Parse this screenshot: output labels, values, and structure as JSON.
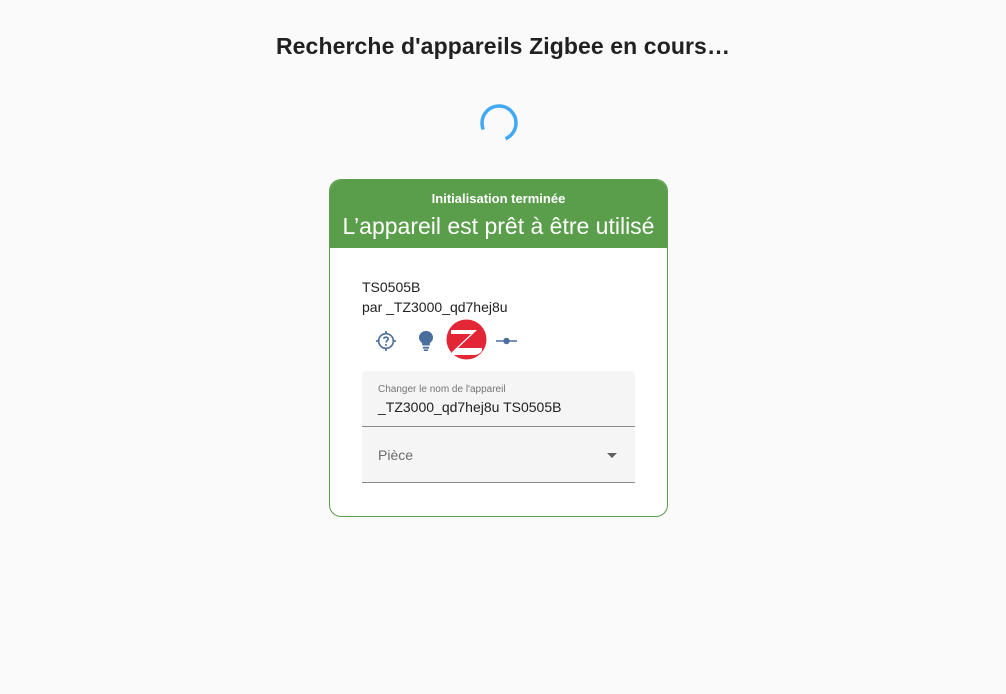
{
  "search": {
    "title": "Recherche d'appareils Zigbee en cours…"
  },
  "card": {
    "status": "Initialisation terminée",
    "headline": "L’appareil est prêt à être utilisé",
    "model": "TS0505B",
    "manufacturer": "par _TZ3000_qd7hej8u",
    "icons": [
      "help-circle-icon",
      "lightbulb-icon",
      "zigbee-logo-icon",
      "connection-icon"
    ],
    "name_field": {
      "label": "Changer le nom de l'appareil",
      "value": "_TZ3000_qd7hej8u TS0505B"
    },
    "room_field": {
      "placeholder": "Pièce"
    }
  },
  "colors": {
    "header_bg": "#5a9e4b",
    "spinner": "#3fa9f5",
    "icon": "#4a6f9c",
    "zigbee_red": "#e32636"
  }
}
